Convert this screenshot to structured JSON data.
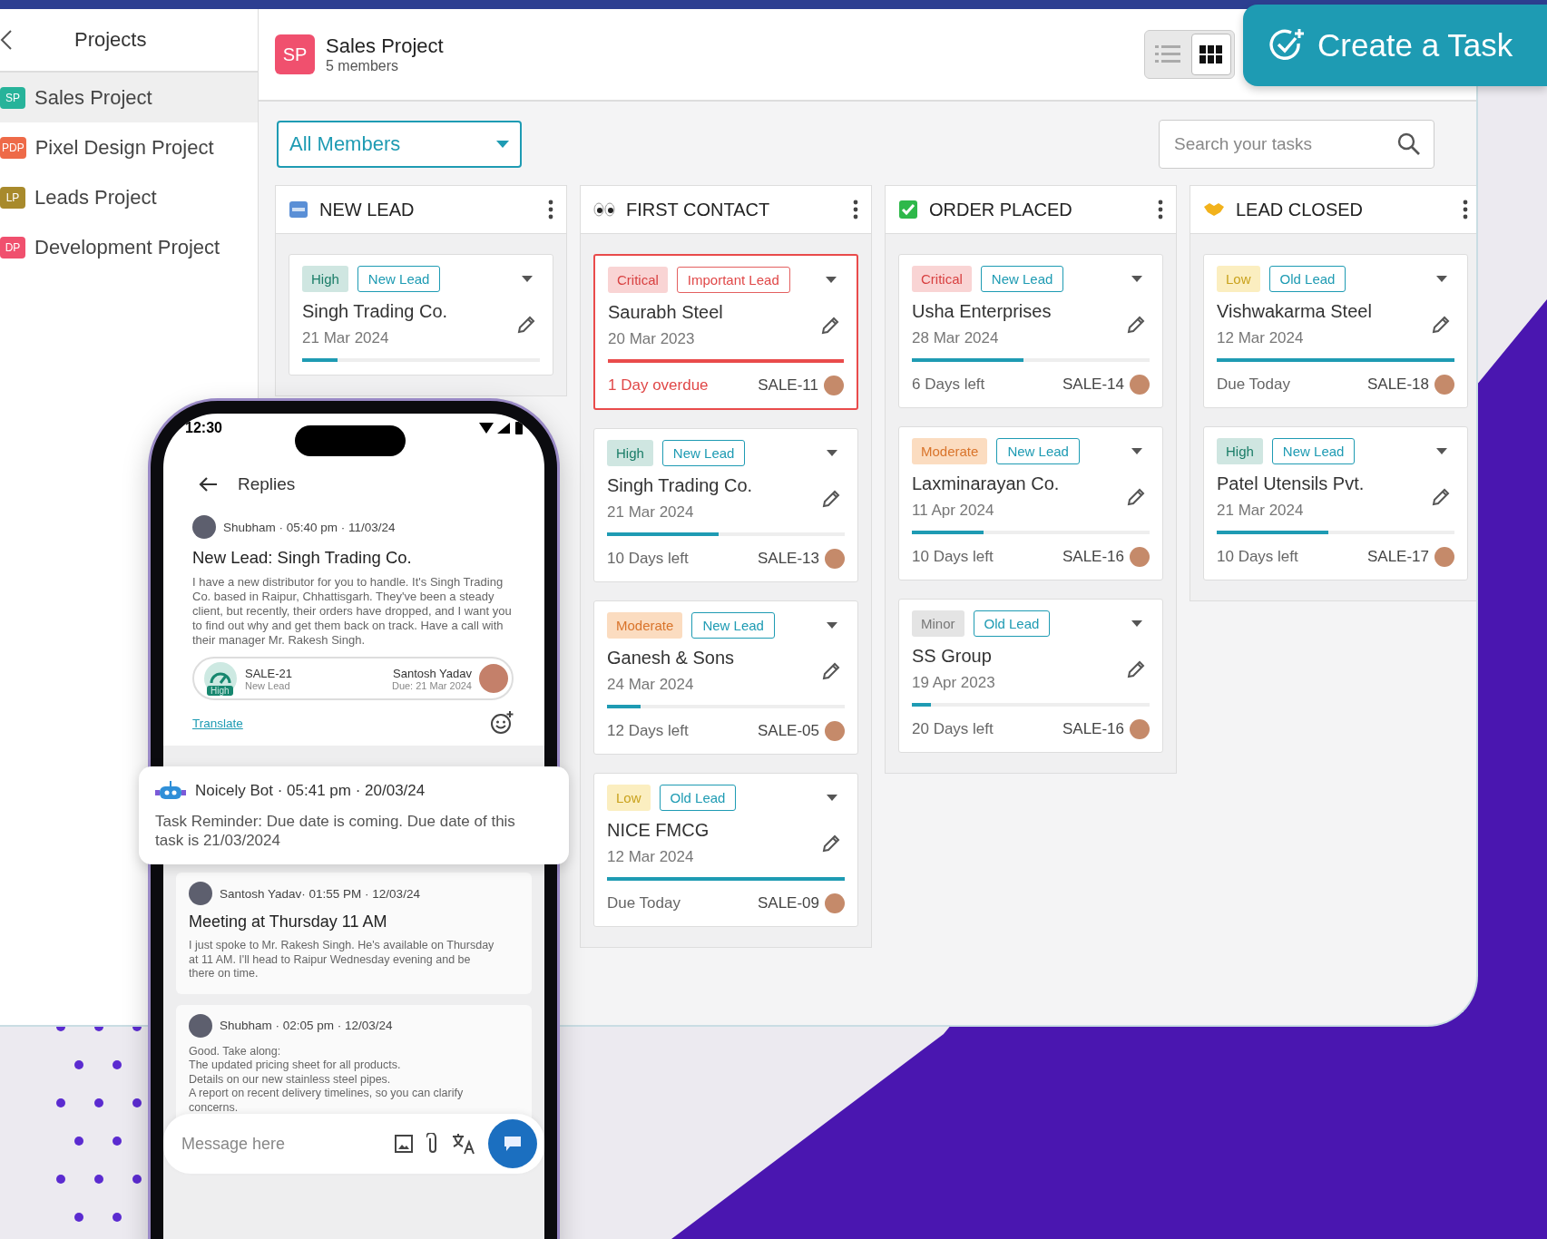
{
  "sidebar": {
    "title": "Projects",
    "items": [
      {
        "initials": "SP",
        "label": "Sales Project",
        "color": "#27b39a",
        "selected": true
      },
      {
        "initials": "PDP",
        "label": "Pixel Design Project",
        "color": "#ee6a48",
        "selected": false
      },
      {
        "initials": "LP",
        "label": "Leads Project",
        "color": "#a88a2c",
        "selected": false
      },
      {
        "initials": "DP",
        "label": "Development Project",
        "color": "#f0506e",
        "selected": false
      }
    ]
  },
  "header": {
    "initials": "SP",
    "title": "Sales Project",
    "subtitle": "5 members",
    "views": [
      {
        "kind": "list",
        "selected": false
      },
      {
        "kind": "grid",
        "selected": true
      }
    ]
  },
  "create_button": {
    "label": "Create a Task"
  },
  "filter": {
    "value": "All Members"
  },
  "search": {
    "placeholder": "Search your tasks"
  },
  "columns": [
    {
      "kind": "new",
      "title": "NEW LEAD",
      "cards": [
        {
          "priority": {
            "label": "High",
            "kind": "high"
          },
          "tag": {
            "label": "New Lead",
            "kind": "normal"
          },
          "title": "Singh Trading Co.",
          "date": "21 Mar 2024",
          "level": 0.15,
          "overdue": false
        }
      ]
    },
    {
      "kind": "eyes",
      "title": "FIRST CONTACT",
      "cards": [
        {
          "priority": {
            "label": "Critical",
            "kind": "critical"
          },
          "tag": {
            "label": "Important Lead",
            "kind": "important"
          },
          "title": "Saurabh Steel",
          "date": "20 Mar 2023",
          "level": 1,
          "status": "1 Day overdue",
          "code": "SALE-11",
          "overdue": true
        },
        {
          "priority": {
            "label": "High",
            "kind": "high"
          },
          "tag": {
            "label": "New Lead",
            "kind": "normal"
          },
          "title": "Singh Trading Co.",
          "date": "21 Mar 2024",
          "level": 0.47,
          "status": "10 Days left",
          "code": "SALE-13",
          "overdue": false
        },
        {
          "priority": {
            "label": "Moderate",
            "kind": "moderate"
          },
          "tag": {
            "label": "New Lead",
            "kind": "normal"
          },
          "title": "Ganesh & Sons",
          "date": "24 Mar 2024",
          "level": 0.14,
          "status": "12 Days left",
          "code": "SALE-05",
          "overdue": false
        },
        {
          "priority": {
            "label": "Low",
            "kind": "low"
          },
          "tag": {
            "label": "Old Lead",
            "kind": "normal"
          },
          "title": "NICE FMCG",
          "date": "12 Mar 2024",
          "level": 1,
          "status": "Due Today",
          "code": "SALE-09",
          "overdue": false
        }
      ]
    },
    {
      "kind": "check",
      "title": "ORDER PLACED",
      "cards": [
        {
          "priority": {
            "label": "Critical",
            "kind": "critical"
          },
          "tag": {
            "label": "New Lead",
            "kind": "normal"
          },
          "title": "Usha Enterprises",
          "date": "28 Mar 2024",
          "level": 0.47,
          "status": "6 Days left",
          "code": "SALE-14",
          "overdue": false
        },
        {
          "priority": {
            "label": "Moderate",
            "kind": "moderate"
          },
          "tag": {
            "label": "New Lead",
            "kind": "normal"
          },
          "title": "Laxminarayan Co.",
          "date": "11 Apr 2024",
          "level": 0.3,
          "status": "10 Days left",
          "code": "SALE-16",
          "overdue": false
        },
        {
          "priority": {
            "label": "Minor",
            "kind": "minor"
          },
          "tag": {
            "label": "Old Lead",
            "kind": "normal"
          },
          "title": "SS Group",
          "date": "19 Apr 2023",
          "level": 0.08,
          "status": "20 Days left",
          "code": "SALE-16",
          "overdue": false
        }
      ]
    },
    {
      "kind": "handshake",
      "title": "LEAD CLOSED",
      "cards": [
        {
          "priority": {
            "label": "Low",
            "kind": "low"
          },
          "tag": {
            "label": "Old Lead",
            "kind": "normal"
          },
          "title": "Vishwakarma Steel",
          "date": "12 Mar 2024",
          "level": 1,
          "status": "Due Today",
          "code": "SALE-18",
          "overdue": false
        },
        {
          "priority": {
            "label": "High",
            "kind": "high"
          },
          "tag": {
            "label": "New Lead",
            "kind": "normal"
          },
          "title": "Patel Utensils Pvt.",
          "date": "21 Mar 2024",
          "level": 0.47,
          "status": "10 Days left",
          "code": "SALE-17",
          "overdue": false
        }
      ]
    }
  ],
  "phone": {
    "time": "12:30",
    "title": "Replies",
    "first_message": {
      "meta": "Shubham · 05:40 pm · 11/03/24",
      "title": "New Lead: Singh Trading Co.",
      "body": "I have a new distributor for you to handle. It's Singh Trading Co. based in Raipur, Chhattisgarh. They've been a steady client, but recently, their orders have dropped, and I want you to find out why and get them back on track. Have a call with their manager Mr. Rakesh Singh.",
      "task": {
        "code": "SALE-21",
        "stage": "New Lead",
        "priority": "High",
        "assignee": "Santosh Yadav",
        "due": "Due: 21 Mar 2024"
      },
      "link": "Translate"
    },
    "notification": {
      "meta": "Noicely Bot · 05:41 pm · 20/03/24",
      "body": "Task Reminder: Due date is coming. Due date of this task is 21/03/2024"
    },
    "messages": [
      {
        "meta": "Santosh Yadav· 01:55 PM · 12/03/24",
        "title": "Meeting at Thursday 11 AM",
        "lines": [
          "I just spoke to Mr. Rakesh Singh. He's available on Thursday at 11 AM. I'll head to Raipur Wednesday evening and be there on time."
        ]
      },
      {
        "meta": "Shubham · 02:05 pm · 12/03/24",
        "lines": [
          "Good. Take along:",
          "The updated pricing sheet for all products.",
          "Details on our new stainless steel pipes.",
          "A report on recent delivery timelines, so you can clarify concerns."
        ]
      }
    ],
    "composer": {
      "placeholder": "Message here"
    }
  }
}
